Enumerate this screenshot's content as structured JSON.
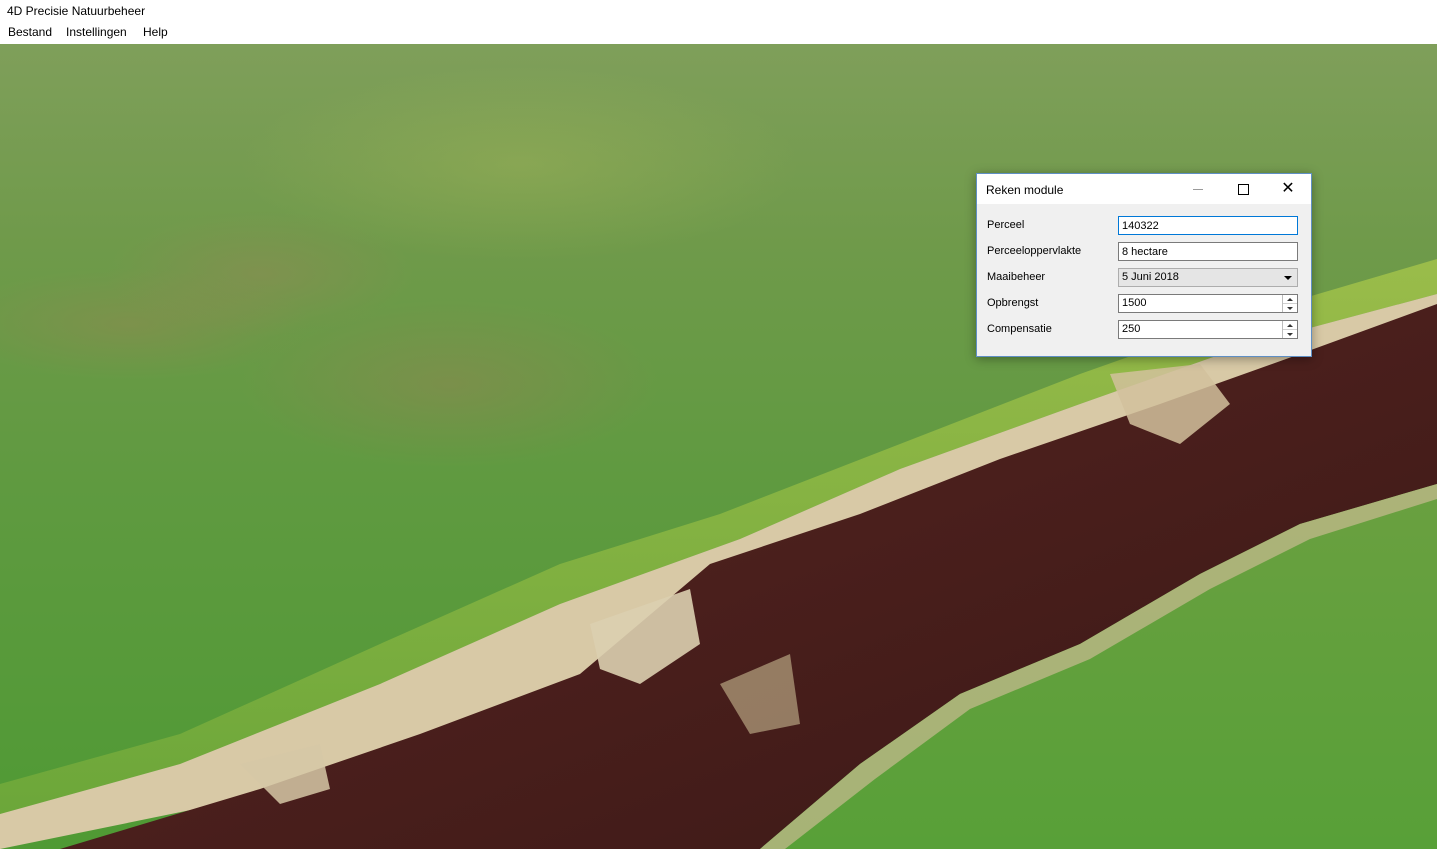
{
  "window": {
    "title": "4D Precisie Natuurbeheer"
  },
  "menu": {
    "items": [
      "Bestand",
      "Instellingen",
      "Help"
    ]
  },
  "scene": {
    "description_icon": "terrain-3d-view"
  },
  "dialog": {
    "title": "Reken module",
    "fields": [
      {
        "label": "Perceel",
        "value": "140322",
        "type": "text"
      },
      {
        "label": "Perceeloppervlakte",
        "value": "8 hectare",
        "type": "text"
      },
      {
        "label": "Maaibeheer",
        "value": "5 Juni 2018",
        "type": "combo"
      },
      {
        "label": "Opbrengst",
        "value": "1500",
        "type": "spin"
      },
      {
        "label": "Compensatie",
        "value": "250",
        "type": "spin"
      }
    ]
  },
  "colors": {
    "accent": "#0078d7",
    "dialog_border": "#5f8fc5",
    "grass": "#5f9a40",
    "water": "#4a1f1c",
    "sand": "#d8c9a6"
  }
}
